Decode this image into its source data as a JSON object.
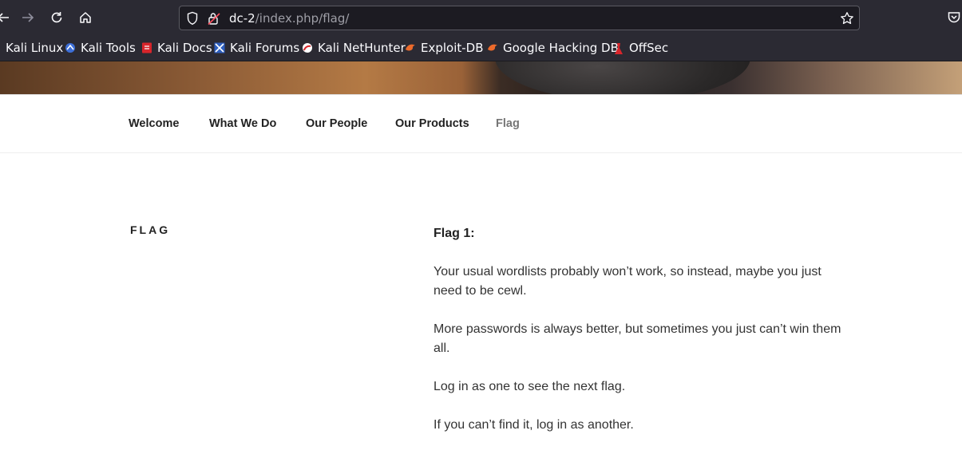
{
  "browser": {
    "url_host": "dc-2",
    "url_path": "/index.php/flag/",
    "bookmarks": [
      {
        "label": "Kali Linux",
        "icon": "kali-dragon-icon"
      },
      {
        "label": "Kali Tools",
        "icon": "kali-tools-icon"
      },
      {
        "label": "Kali Docs",
        "icon": "kali-docs-icon"
      },
      {
        "label": "Kali Forums",
        "icon": "kali-forums-icon"
      },
      {
        "label": "Kali NetHunter",
        "icon": "nethunter-icon"
      },
      {
        "label": "Exploit-DB",
        "icon": "exploit-db-icon"
      },
      {
        "label": "Google Hacking DB",
        "icon": "ghdb-icon"
      },
      {
        "label": "OffSec",
        "icon": "offsec-icon"
      }
    ]
  },
  "site_nav": {
    "items": [
      {
        "label": "Welcome"
      },
      {
        "label": "What We Do"
      },
      {
        "label": "Our People"
      },
      {
        "label": "Our Products"
      },
      {
        "label": "Flag",
        "current": true
      }
    ]
  },
  "page": {
    "title": "FLAG",
    "heading": "Flag 1:",
    "paragraphs": [
      "Your usual wordlists probably won’t work, so instead, maybe you just need to be cewl.",
      "More passwords is always better, but sometimes you just can’t win them all.",
      "Log in as one to see the next flag.",
      "If you can’t find it, log in as another."
    ]
  }
}
